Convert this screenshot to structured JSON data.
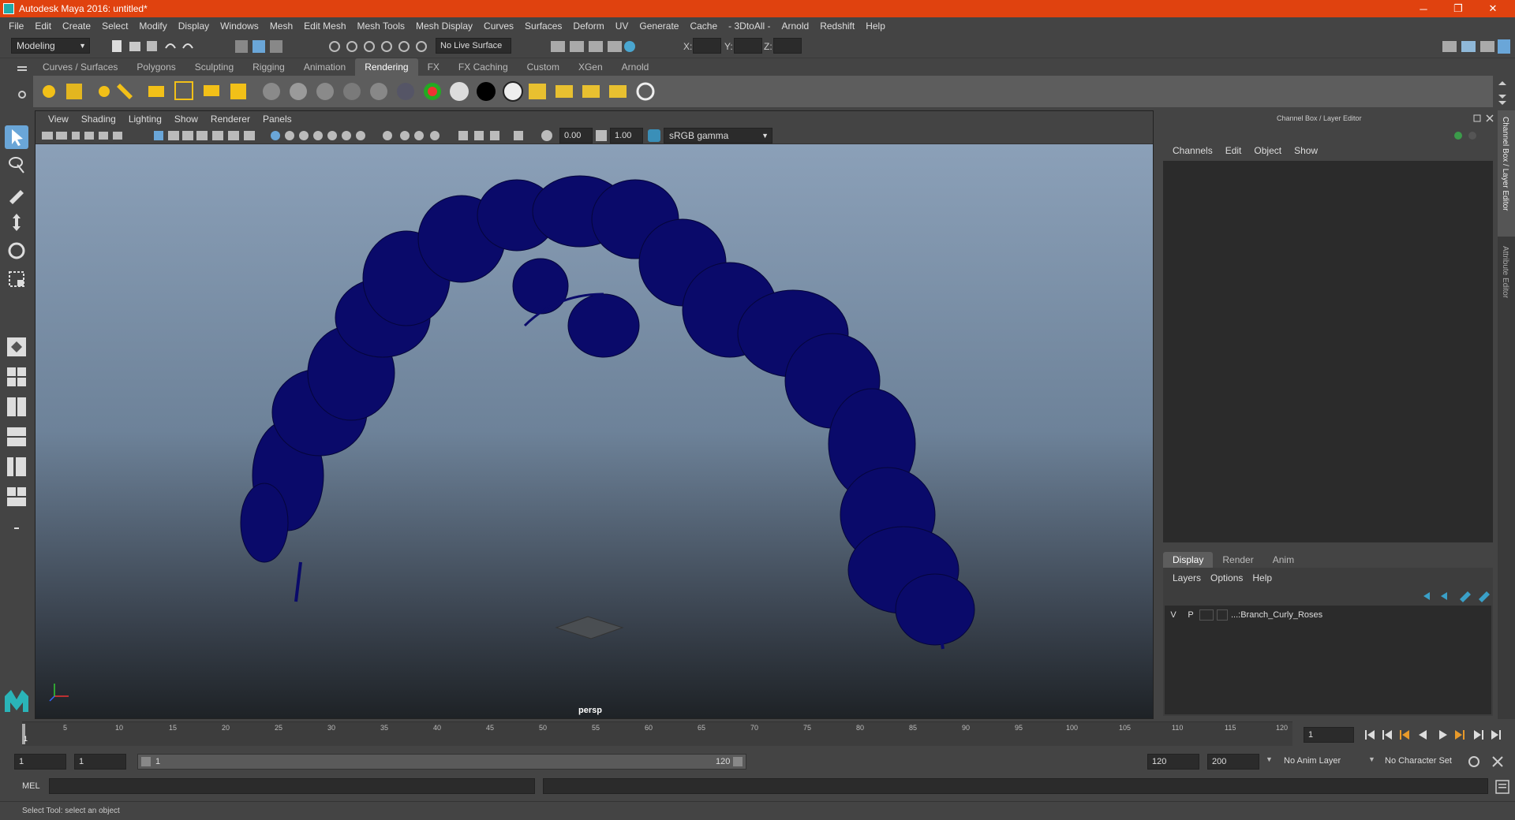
{
  "window": {
    "title": "Autodesk Maya 2016: untitled*",
    "minimize": "─",
    "maximize": "❐",
    "close": "✕"
  },
  "menubar": [
    "File",
    "Edit",
    "Create",
    "Select",
    "Modify",
    "Display",
    "Windows",
    "Mesh",
    "Edit Mesh",
    "Mesh Tools",
    "Mesh Display",
    "Curves",
    "Surfaces",
    "Deform",
    "UV",
    "Generate",
    "Cache",
    "- 3DtoAll -",
    "Arnold",
    "Redshift",
    "Help"
  ],
  "statusline": {
    "mode": "Modeling",
    "live_surface": "No Live Surface",
    "x_label": "X:",
    "y_label": "Y:",
    "z_label": "Z:"
  },
  "shelf": {
    "tabs": [
      "Curves / Surfaces",
      "Polygons",
      "Sculpting",
      "Rigging",
      "Animation",
      "Rendering",
      "FX",
      "FX Caching",
      "Custom",
      "XGen",
      "Arnold"
    ],
    "active_tab": "Rendering"
  },
  "viewport": {
    "menu": [
      "View",
      "Shading",
      "Lighting",
      "Show",
      "Renderer",
      "Panels"
    ],
    "exposure": "0.00",
    "gamma": "1.00",
    "color_space": "sRGB gamma",
    "camera_label": "persp",
    "object_color": "#0a0a6a"
  },
  "channelbox": {
    "title": "Channel Box / Layer Editor",
    "menu": [
      "Channels",
      "Edit",
      "Object",
      "Show"
    ],
    "layer_tabs": [
      "Display",
      "Render",
      "Anim"
    ],
    "active_layer_tab": "Display",
    "layer_menu": [
      "Layers",
      "Options",
      "Help"
    ],
    "layers": [
      {
        "v": "V",
        "p": "P",
        "name": "...:Branch_Curly_Roses"
      }
    ],
    "side_tabs": [
      "Channel Box / Layer Editor",
      "Attribute Editor"
    ]
  },
  "timeline": {
    "ticks": [
      "1",
      "5",
      "10",
      "15",
      "20",
      "25",
      "30",
      "35",
      "40",
      "45",
      "50",
      "55",
      "60",
      "65",
      "70",
      "75",
      "80",
      "85",
      "90",
      "95",
      "100",
      "105",
      "110",
      "115",
      "120"
    ],
    "current_frame": "1"
  },
  "range": {
    "start": "1",
    "playback_start": "1",
    "slider_start": "1",
    "slider_end": "120",
    "playback_end": "120",
    "end": "200",
    "anim_layer": "No Anim Layer",
    "character_set": "No Character Set"
  },
  "cmdline": {
    "label": "MEL"
  },
  "helpline": {
    "text": "Select Tool: select an object"
  }
}
